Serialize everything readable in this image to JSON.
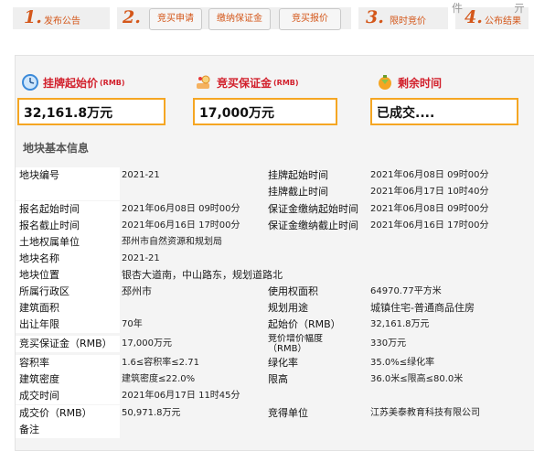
{
  "steps": {
    "s1_num": "1.",
    "s1_label": "发布公告",
    "s2_num": "2.",
    "sub1": "竞买申请",
    "sub2": "缴纳保证金",
    "sub3": "竞买报价",
    "s3_num": "3.",
    "s3_label": "限时竞价",
    "s4_num": "4.",
    "s4_label": "公布结果",
    "corner1": "件",
    "corner2": "亓"
  },
  "summary": {
    "start_price_label": "挂牌起始价",
    "start_price_unit": "(RMB)",
    "start_price_value": "32,161.8万元",
    "deposit_label": "竞买保证金",
    "deposit_unit": "(RMB)",
    "deposit_value": "17,000万元",
    "remaining_label": "剩余时间",
    "remaining_value": "已成交...."
  },
  "section_title": "地块基本信息",
  "rows": [
    {
      "l1": "地块编号",
      "v1": "2021-21",
      "l2": "挂牌起始时间",
      "v2": "2021年06月08日 09时00分"
    },
    {
      "l1": "",
      "v1": "",
      "l2": "挂牌截止时间",
      "v2": "2021年06月17日 10时40分"
    },
    {
      "l1": "报名起始时间",
      "v1": "2021年06月08日 09时00分",
      "l2": "保证金缴纳起始时间",
      "v2": "2021年06月08日 09时00分"
    },
    {
      "l1": "报名截止时间",
      "v1": "2021年06月16日 17时00分",
      "l2": "保证金缴纳截止时间",
      "v2": "2021年06月16日 17时00分"
    },
    {
      "l1": "土地权属单位",
      "v1": "邳州市自然资源和规划局",
      "l2": "",
      "v2": ""
    },
    {
      "l1": "地块名称",
      "v1": "2021-21",
      "l2": "",
      "v2": ""
    },
    {
      "l1": "地块位置",
      "v1": "银杏大道南，中山路东，规划道路北",
      "l2": "",
      "v2": ""
    },
    {
      "l1": "所属行政区",
      "v1": "邳州市",
      "l2": "使用权面积",
      "v2": "64970.77平方米"
    },
    {
      "l1": "建筑面积",
      "v1": "",
      "l2": "规划用途",
      "v2": "城镇住宅-普通商品住房"
    },
    {
      "l1": "出让年限",
      "v1": "70年",
      "l2": "起始价（RMB）",
      "v2": "32,161.8万元"
    },
    {
      "l1": "竞买保证金（RMB）",
      "v1": "17,000万元",
      "l2": "竞价增价幅度（RMB）",
      "v2": "330万元"
    },
    {
      "l1": "容积率",
      "v1": "1.6≤容积率≤2.71",
      "l2": "绿化率",
      "v2": "35.0%≤绿化率"
    },
    {
      "l1": "建筑密度",
      "v1": "建筑密度≤22.0%",
      "l2": "限高",
      "v2": "36.0米≤限高≤80.0米"
    },
    {
      "l1": "成交时间",
      "v1": "2021年06月17日 11时45分",
      "l2": "",
      "v2": ""
    },
    {
      "l1": "成交价（RMB）",
      "v1": "50,971.8万元",
      "l2": "竞得单位",
      "v2": "江苏美泰教育科技有限公司"
    },
    {
      "l1": "备注",
      "v1": "",
      "l2": "",
      "v2": ""
    }
  ]
}
